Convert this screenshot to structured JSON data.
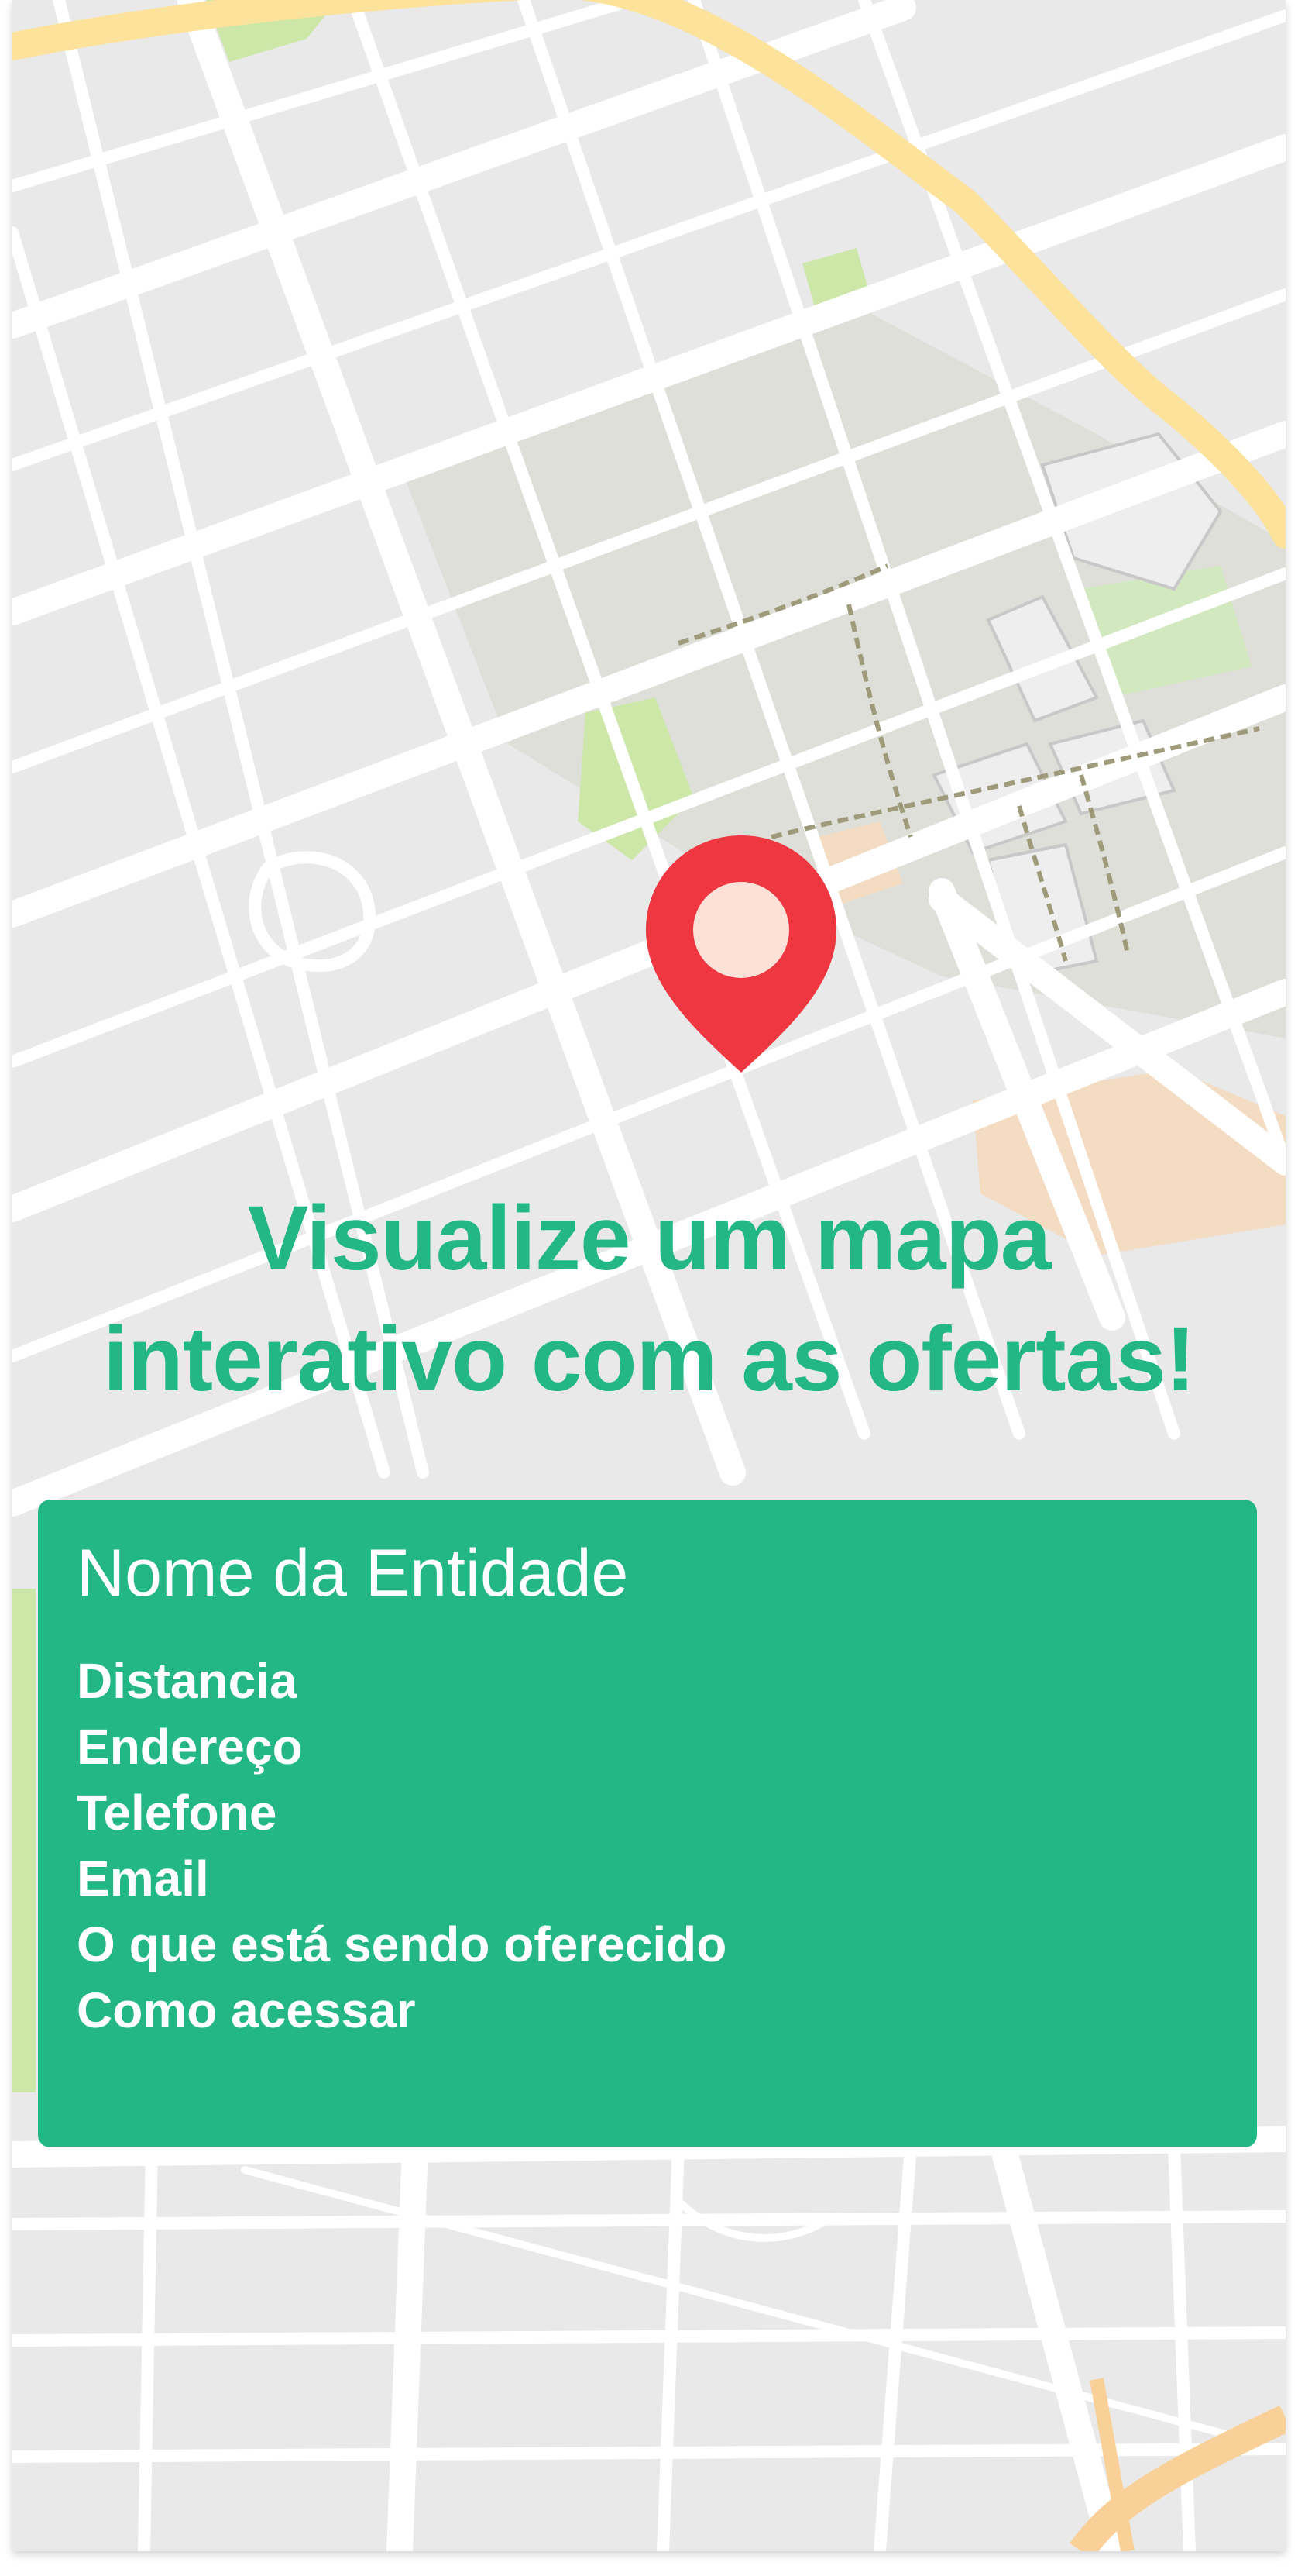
{
  "map": {
    "colors": {
      "background": "#e9e9e9",
      "road": "#ffffff",
      "highway": "#fde29b",
      "campus": "#dcdcd6",
      "park": "#cde7a8",
      "sand": "#f3dcc1",
      "path": "#9e9a7a"
    }
  },
  "pin": {
    "icon": "map-pin-icon",
    "color": "#ee3740",
    "inner_color": "#fbe1d7"
  },
  "headline": "Visualize um mapa interativo com as ofertas!",
  "entity_card": {
    "background": "#22b785",
    "title": "Nome da Entidade",
    "fields": [
      "Distancia",
      "Endereço",
      "Telefone",
      "Email",
      "O que está sendo oferecido",
      "Como acessar"
    ]
  }
}
